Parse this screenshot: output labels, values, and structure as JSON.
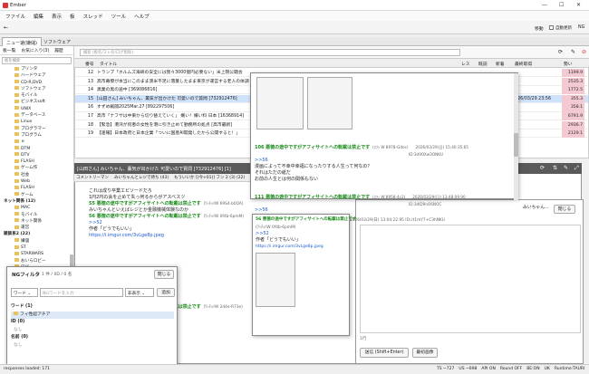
{
  "app": {
    "title": "Ember"
  },
  "menu": [
    "ファイル",
    "編集",
    "表示",
    "板",
    "スレッド",
    "ツール",
    "ヘルプ"
  ],
  "url": {
    "value": "https://greta.5ch.io/test/read.cgi/poverty/1774754741/",
    "move_label": "移動",
    "checkbox_label": "自動更新",
    "ng_label": "NG"
  },
  "tabs": [
    {
      "label": "ニュー速(嫌儲)"
    },
    {
      "label": "ソフトウェア"
    }
  ],
  "left": {
    "tabs": [
      "板一覧",
      "お気に入り(3)",
      "履歴"
    ],
    "search_placeholder": "板を検索",
    "items": [
      "プリンタ",
      "ハードウェア",
      "CD-R,DVD",
      "ソフトウェア",
      "モバイル",
      "ビジネスsoft",
      "UNIX",
      "データベース",
      "Linux",
      "プログラマー",
      "プログラム",
      "ｅ",
      "DTM",
      "DTV",
      "FLASH",
      "ゲーム作",
      "社会",
      "Web",
      "FLASH",
      "ゲーム",
      "MAC",
      "モバイル",
      "ネット関係",
      "運営",
      "嫌儲",
      "ST",
      "STARWARS",
      "おいらロビー",
      "ロビー",
      "モ",
      "なんでも",
      "変",
      "郷",
      "ニュー",
      "最近",
      "まちBBS",
      "人間",
      "Linux"
    ],
    "sections": [
      "ネット関係 (12)",
      "雑談系2 (22)"
    ]
  },
  "thread_list": {
    "search_placeholder": "検索 (板名/スレ名/ログ削除)",
    "headers": [
      "番号",
      "タイトル",
      "レス",
      "既読",
      "新着",
      "最終取得",
      "勢い"
    ],
    "rows": [
      {
        "num": "12",
        "title": "トランプ「ホルムズ海峡の安全には我々3000億円必要ない」米上院公聴会",
        "vote": "1199.9"
      },
      {
        "num": "13",
        "title": "高市幕僚が本当にこのまま渡米不足に落葉したまま東京が運営する老人の体調",
        "vote": "2535.3"
      },
      {
        "num": "14",
        "title": "黒業の黒の途中 [369086816]",
        "vote": "1772.5"
      },
      {
        "num": "15",
        "title": "[山田さん] みいちゃん、薫気が出かけた 可愛いので質問 [732912476]",
        "date": "2026/03/29 23:56",
        "vote": "355.3",
        "selected": true
      },
      {
        "num": "16",
        "title": "すずめ戦闘2025Mar.27 [892297506]",
        "vote": "358.1"
      },
      {
        "num": "17",
        "title": "高市「ナフサは中東から切り替えていく」 嬢い！嬢い料 日本 [16368914]",
        "vote": "6791.9"
      },
      {
        "num": "18",
        "title": "【緊急】港湾が何者の女性を港に引き止めて勤務所の処点 [高市最新]",
        "vote": "2936.7"
      },
      {
        "num": "19",
        "title": "【速報】日本政府と日本企業「ついに国産AI開発したから公開すると！」",
        "vote": "2129.1"
      }
    ]
  },
  "response": {
    "header": "[山田さん] みいちゃん、薫気が出かけた 可愛いので質問 [732912476] [1]",
    "tabs": [
      "コメントリーマン",
      "みいちゃんとレジで待ち (43)",
      "もういいか [(今+01)] フン 2 (3) (22)",
      "[薫感]-米国製の山田さん"
    ],
    "posts": [
      {
        "text": "これは成り卒業エピソードだろ"
      },
      {
        "text": "1円2円の会を止めて失っ何るからがアスベスツ"
      },
      {
        "head": "55 悪徳の途中ですがアフィサイトへの転載は禁止です",
        "meta": "(ﾜｯﾁｮｲW 69S4-b0OA)"
      },
      {
        "text": "みいちゃんといえばレジとか金融機械体験なのか"
      },
      {
        "head": "56 悪徳の途中ですがアフィサイトへの転載は禁止です",
        "meta": "(ﾜｯﾁｮｲW 0f4b-6pmM)"
      },
      {
        "link": ">>52"
      },
      {
        "text": "作者「どうでもいい」"
      },
      {
        "link": "https://i.imgur.com/3vLge8p.jpeg"
      },
      {
        "head": "57 悪徳の途中ですがアフィサイトへの転載は禁止です",
        "meta": "(ﾜｯﾁｮｲW 2d4e-R73e)"
      },
      {
        "text": "つるつるのみいちゃんです"
      }
    ]
  },
  "popup_main": {
    "posts": [
      {
        "head": "106 悪徳の途中ですがアフィサイトへの転載は禁止です",
        "meta": "(ｽﾌｯ W 8978-Gdoc)",
        "date": "2026/03/29(日) 15:40:35.65",
        "id": "ID:3d9OXw3ONKU"
      },
      {
        "link": ">>56"
      },
      {
        "text": "漫画によって不幸中幸福になったりする人生って何なの？"
      },
      {
        "text": "それはただの紙だ"
      },
      {
        "text": "お前の人生とは何の関係もない"
      },
      {
        "head": "111 悪徳の途中ですがアフィサイトへの転載は禁止です",
        "meta": "(ｽﾌｯ W 8958-4c2)",
        "date": "2026/03/29(日) 13:48:09.90",
        "id": "ID:3dID9nO6NOC"
      },
      {
        "link": ">>56"
      }
    ]
  },
  "popup_sub": {
    "head": "56 悪徳の途中ですがアフィサイトへの転載は禁止です",
    "meta": "(ﾜｯﾁｮｲW 0f4b-6pmM)",
    "date": "2026/03/29(日) 13:04:22.95",
    "id": "ID:ct1mY7+C3hNKU",
    "link": ">>52",
    "text": "作者「どうでもいい」",
    "url": "https://i.imgur.com/3vLge8p.jpeg"
  },
  "reply": {
    "author": "みいちゃん…",
    "close": "閉じる",
    "mail_label": "sage",
    "count": "1行",
    "submit": "送信 (Shift+Enter)",
    "preview": "最初画像"
  },
  "ng": {
    "title": "NGフィルタ",
    "count": "1 件 / 0D / 0 名",
    "close_label": "閉じる",
    "field_select": "ワード",
    "input_placeholder": "NGワードを入力",
    "mode_select": "非表示",
    "add_label": "追加",
    "groups": [
      {
        "label": "ワード (1)",
        "items": [
          "フィ性認アチア"
        ]
      },
      {
        "label": "ID (0)",
        "items": [
          "なし"
        ]
      },
      {
        "label": "名前 (0)",
        "items": [
          "なし"
        ]
      }
    ]
  },
  "status": {
    "left": "responses loaded: 171",
    "right": [
      "TS ~727",
      "US ~698",
      "API ON",
      "Round OFF",
      "BE:ON",
      "UK",
      "Runtime:TAURI"
    ]
  }
}
